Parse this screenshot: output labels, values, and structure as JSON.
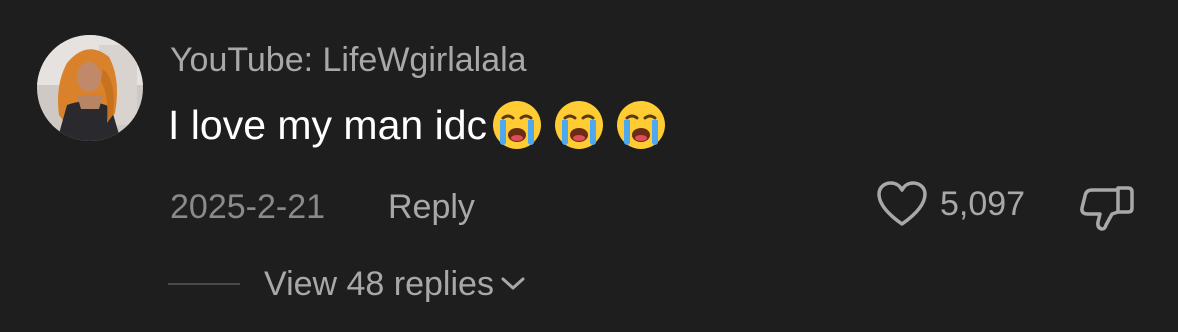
{
  "comment": {
    "author": "YouTube: LifeWgirlalala",
    "text": "I love my man idc",
    "emojis": [
      "loudly-crying-face-icon",
      "loudly-crying-face-icon",
      "loudly-crying-face-icon"
    ],
    "date": "2025-2-21",
    "reply_label": "Reply",
    "like_count": "5,097",
    "view_replies_label": "View 48 replies"
  },
  "colors": {
    "background": "#1e1e1e",
    "text_primary": "#ffffff",
    "text_secondary": "#a8a8a8",
    "text_muted": "#8a8a8a"
  },
  "icons": {
    "like": "heart-icon",
    "dislike": "thumbs-down-icon",
    "expand": "chevron-down-icon"
  }
}
